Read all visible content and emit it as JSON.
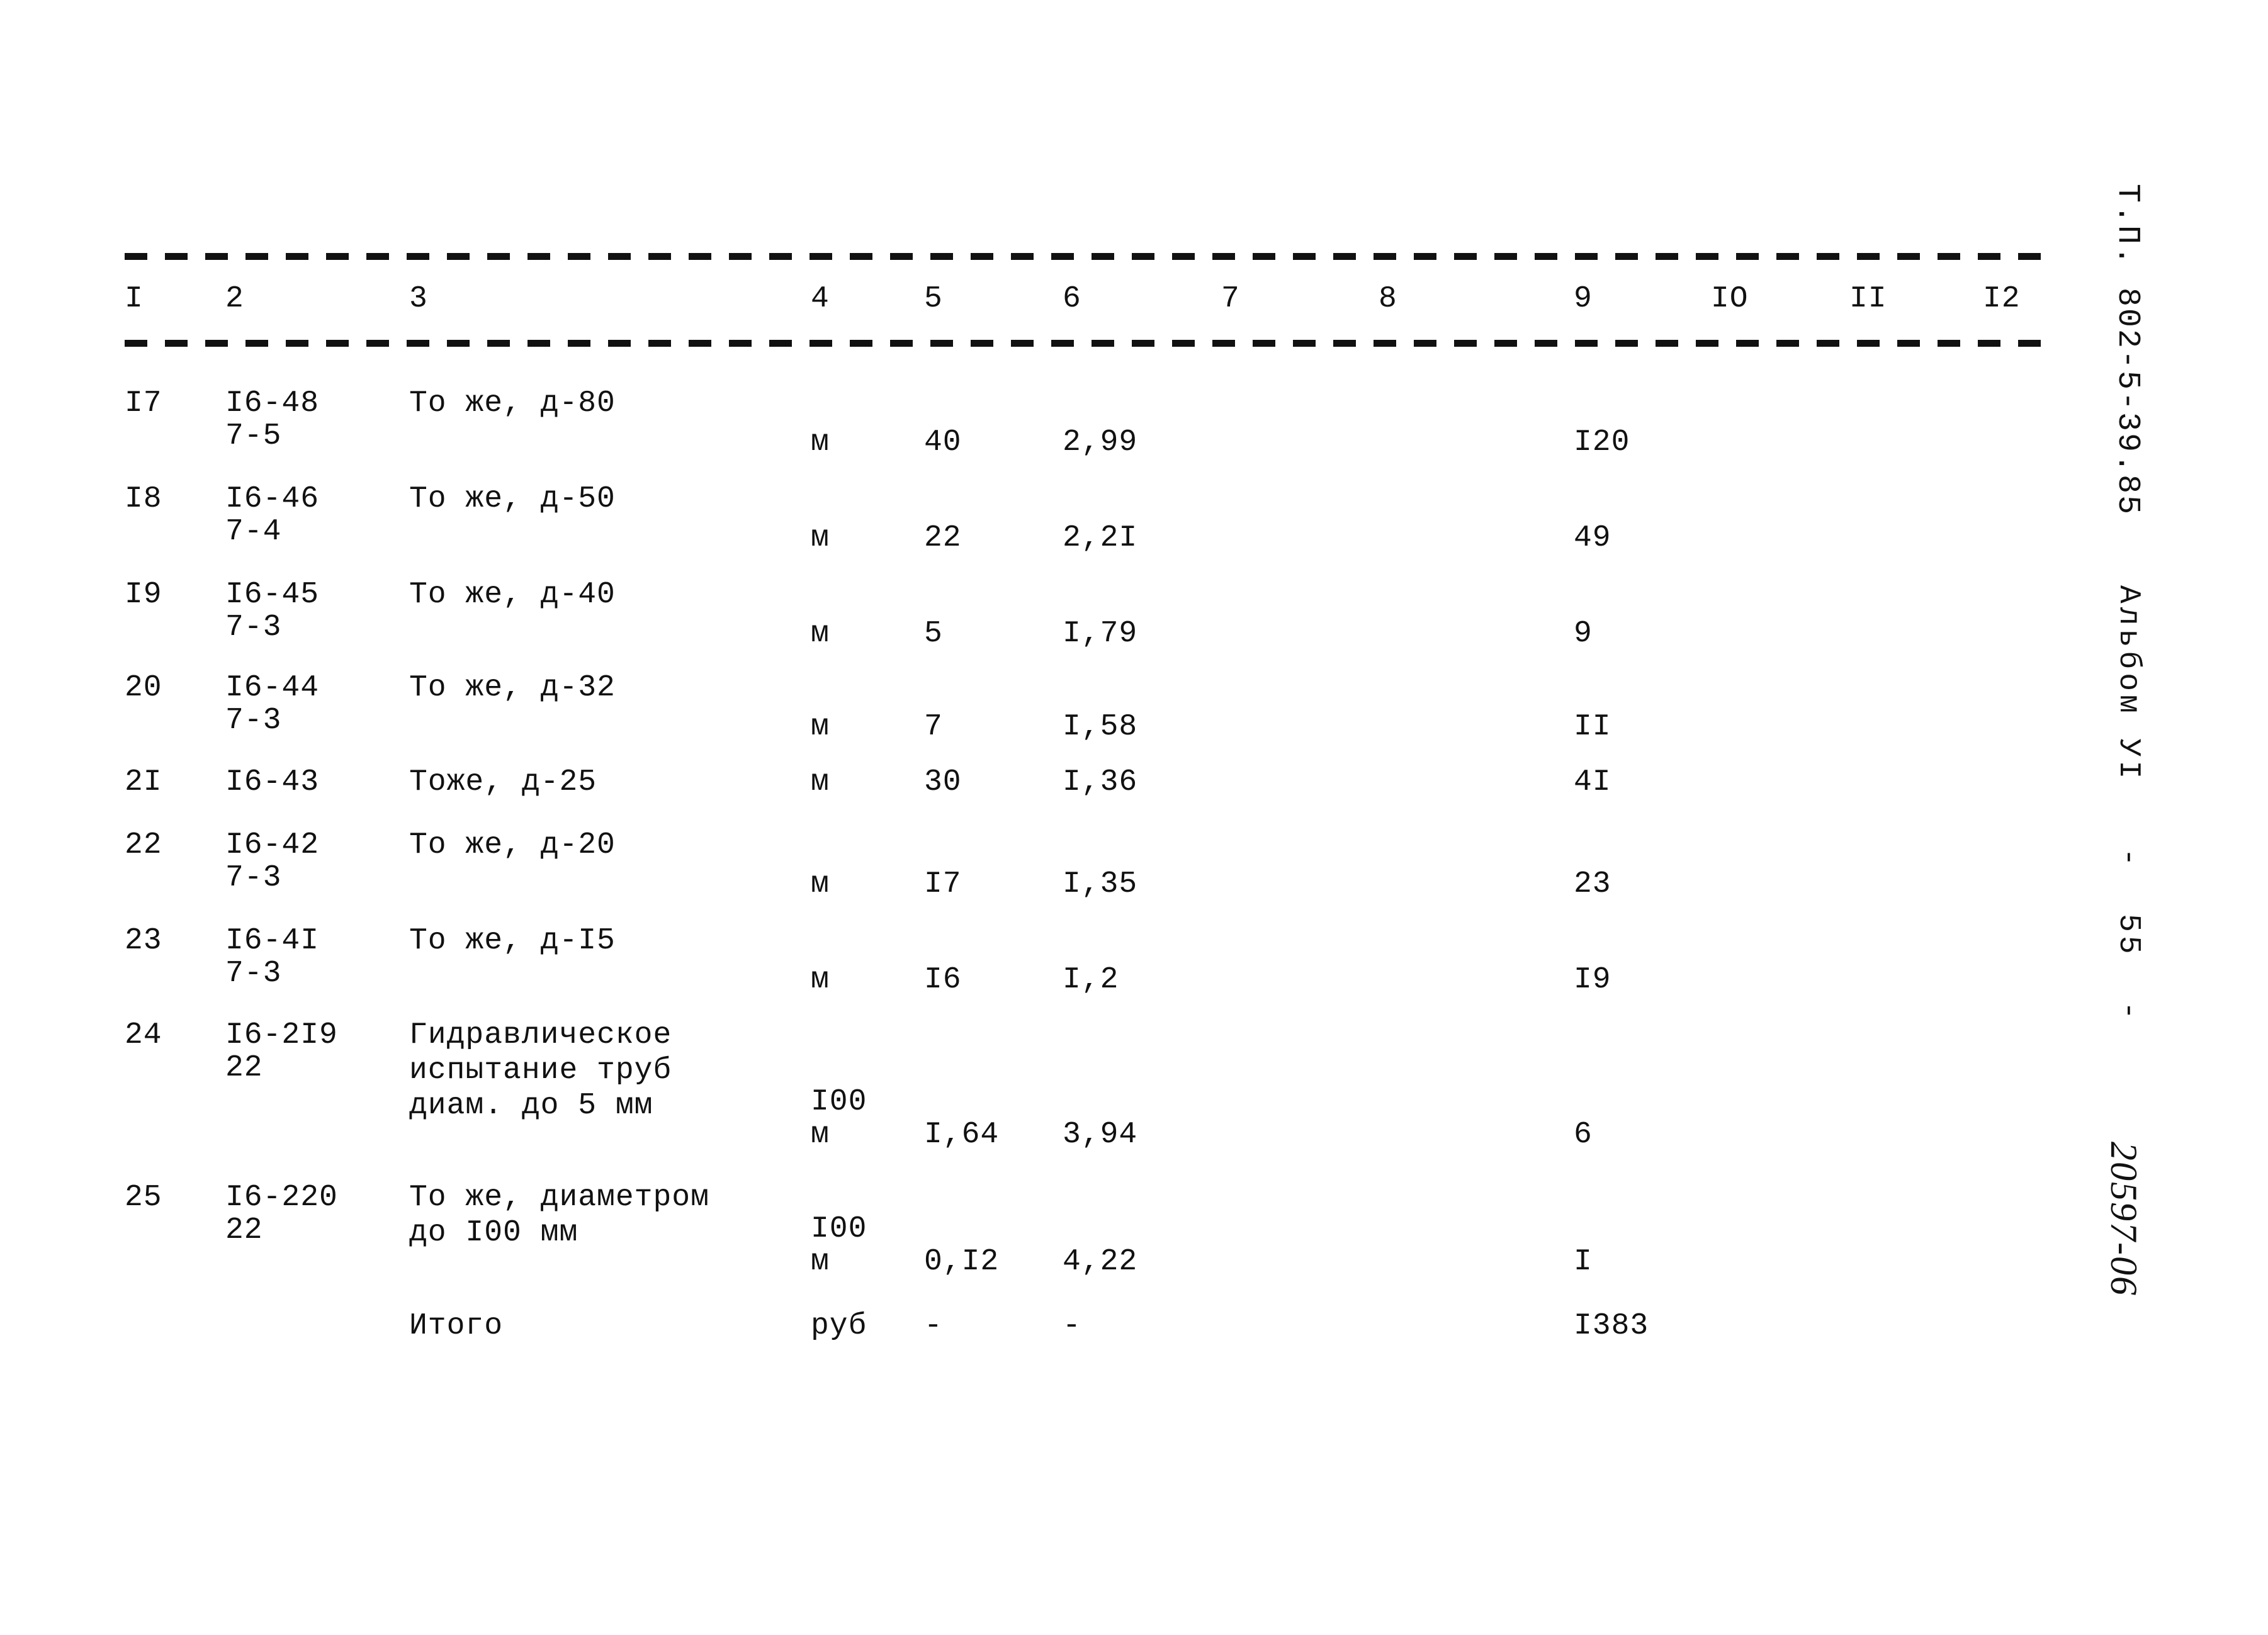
{
  "document": {
    "code_label": "Т.П. 802-5-39.85",
    "album_label": "Альбом УI   -  55  -",
    "sheet_number": "20597-06"
  },
  "table": {
    "column_headers": [
      "I",
      "2",
      "3",
      "4",
      "5",
      "6",
      "7",
      "8",
      "9",
      "IO",
      "II",
      "I2"
    ],
    "rows": [
      {
        "no": "I7",
        "code_line1": "I6-48",
        "code_line2": "7-5",
        "desc_line1": "То же, д-80",
        "desc_line2": "",
        "desc_line3": "",
        "unit_line1": "",
        "unit_line2": "м",
        "qty": "40",
        "price": "2,99",
        "col7": "",
        "col8": "",
        "total": "I20",
        "col10": "",
        "col11": "",
        "col12": ""
      },
      {
        "no": "I8",
        "code_line1": "I6-46",
        "code_line2": "7-4",
        "desc_line1": "То же, д-50",
        "desc_line2": "",
        "desc_line3": "",
        "unit_line1": "",
        "unit_line2": "м",
        "qty": "22",
        "price": "2,2I",
        "col7": "",
        "col8": "",
        "total": "49",
        "col10": "",
        "col11": "",
        "col12": ""
      },
      {
        "no": "I9",
        "code_line1": "I6-45",
        "code_line2": "7-3",
        "desc_line1": "То же, д-40",
        "desc_line2": "",
        "desc_line3": "",
        "unit_line1": "",
        "unit_line2": "м",
        "qty": "5",
        "price": "I,79",
        "col7": "",
        "col8": "",
        "total": "9",
        "col10": "",
        "col11": "",
        "col12": ""
      },
      {
        "no": "20",
        "code_line1": "I6-44",
        "code_line2": "7-3",
        "desc_line1": "То же, д-32",
        "desc_line2": "",
        "desc_line3": "",
        "unit_line1": "",
        "unit_line2": "м",
        "qty": "7",
        "price": "I,58",
        "col7": "",
        "col8": "",
        "total": "II",
        "col10": "",
        "col11": "",
        "col12": ""
      },
      {
        "no": "2I",
        "code_line1": "I6-43",
        "code_line2": "",
        "desc_line1": "Тоже, д-25",
        "desc_line2": "",
        "desc_line3": "",
        "unit_line1": "",
        "unit_line2": "м",
        "qty": "30",
        "price": "I,36",
        "col7": "",
        "col8": "",
        "total": "4I",
        "col10": "",
        "col11": "",
        "col12": ""
      },
      {
        "no": "22",
        "code_line1": "I6-42",
        "code_line2": "7-3",
        "desc_line1": "То же, д-20",
        "desc_line2": "",
        "desc_line3": "",
        "unit_line1": "",
        "unit_line2": "м",
        "qty": "I7",
        "price": "I,35",
        "col7": "",
        "col8": "",
        "total": "23",
        "col10": "",
        "col11": "",
        "col12": ""
      },
      {
        "no": "23",
        "code_line1": "I6-4I",
        "code_line2": "7-3",
        "desc_line1": "То же, д-I5",
        "desc_line2": "",
        "desc_line3": "",
        "unit_line1": "",
        "unit_line2": "м",
        "qty": "I6",
        "price": "I,2",
        "col7": "",
        "col8": "",
        "total": "I9",
        "col10": "",
        "col11": "",
        "col12": ""
      },
      {
        "no": "24",
        "code_line1": "I6-2I9",
        "code_line2": "22",
        "desc_line1": "Гидравлическое",
        "desc_line2": "испытание труб",
        "desc_line3": "диам. до 5 мм",
        "unit_line1": "I00",
        "unit_line2": "м",
        "qty": "I,64",
        "price": "3,94",
        "col7": "",
        "col8": "",
        "total": "6",
        "col10": "",
        "col11": "",
        "col12": ""
      },
      {
        "no": "25",
        "code_line1": "I6-220",
        "code_line2": "22",
        "desc_line1": "То же, диаметром",
        "desc_line2": "до I00 мм",
        "desc_line3": "",
        "unit_line1": "I00",
        "unit_line2": "м",
        "qty": "0,I2",
        "price": "4,22",
        "col7": "",
        "col8": "",
        "total": "I",
        "col10": "",
        "col11": "",
        "col12": ""
      },
      {
        "no": "",
        "code_line1": "",
        "code_line2": "",
        "desc_line1": "Итого",
        "desc_line2": "",
        "desc_line3": "",
        "unit_line1": "",
        "unit_line2": "руб",
        "qty": "-",
        "price": "-",
        "col7": "",
        "col8": "",
        "total": "I383",
        "col10": "",
        "col11": "",
        "col12": ""
      }
    ]
  }
}
